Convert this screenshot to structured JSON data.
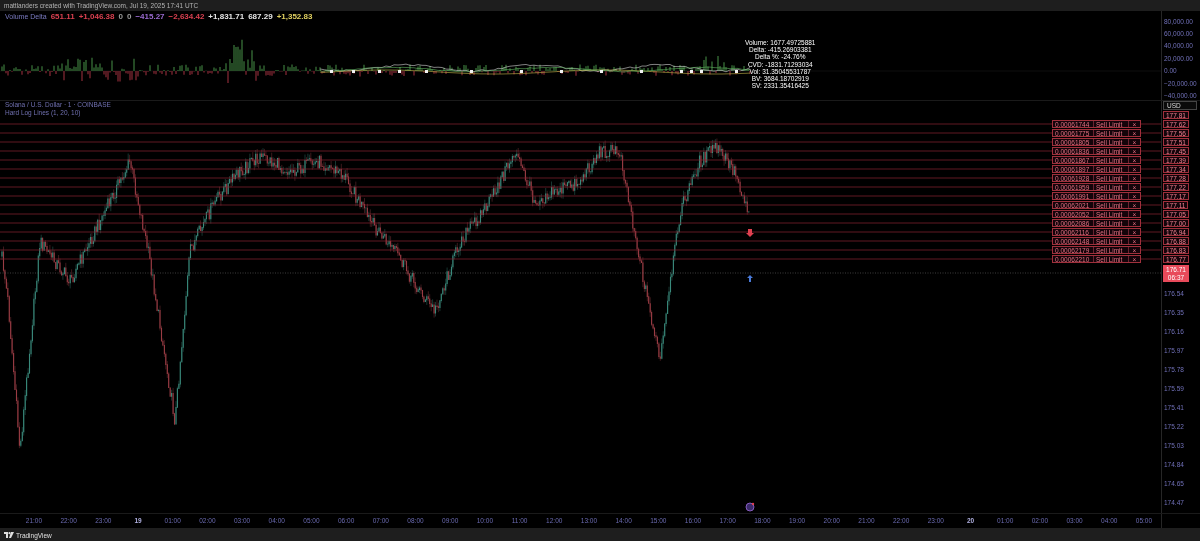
{
  "header": {
    "caption": "mattlanders created with TradingView.com, Jul 19, 2025 17:41 UTC"
  },
  "indicator_pane": {
    "legend": {
      "title": "Volume Delta",
      "values": [
        {
          "text": "651.11",
          "color": "#d94050"
        },
        {
          "text": "+1,046.38",
          "color": "#d94050"
        },
        {
          "text": "0",
          "color": "#9a9a9a"
        },
        {
          "text": "0",
          "color": "#9a9a9a"
        },
        {
          "text": "−415.27",
          "color": "#9a6ad0"
        },
        {
          "text": "−2,634.42",
          "color": "#d94050"
        },
        {
          "text": "+1,831.71",
          "color": "#e6e6e6"
        },
        {
          "text": "687.29",
          "color": "#e6e6e6"
        },
        {
          "text": "+1,352.83",
          "color": "#e0d060"
        }
      ]
    },
    "tooltip": [
      "Volume: 1677.49725881",
      "Delta: -415.26903381",
      "Delta %: -24.76%",
      "CVD: -1831.71293034",
      "Vol: 31.35045531787",
      "BV: 3684.18702919",
      "SV: 2331.35416425"
    ],
    "axis_labels": [
      "80,000.00",
      "60,000.00",
      "40,000.00",
      "20,000.00",
      "0.00",
      "−20,000.00",
      "−40,000.00"
    ]
  },
  "main_pane": {
    "legend": [
      "Solana / U.S. Dollar · 1 · COINBASE",
      "Hard Log Lines (1, 20, 10)"
    ],
    "currency_button": "USD",
    "top_price_label": "177.81",
    "orders": [
      {
        "quantity": "0.00061744",
        "type": "Sell Limit",
        "close": "×",
        "price": "177.62"
      },
      {
        "quantity": "0.00061775",
        "type": "Sell Limit",
        "close": "×",
        "price": "177.56"
      },
      {
        "quantity": "0.00061805",
        "type": "Sell Limit",
        "close": "×",
        "price": "177.51"
      },
      {
        "quantity": "0.00061836",
        "type": "Sell Limit",
        "close": "×",
        "price": "177.45"
      },
      {
        "quantity": "0.00061867",
        "type": "Sell Limit",
        "close": "×",
        "price": "177.39"
      },
      {
        "quantity": "0.00061897",
        "type": "Sell Limit",
        "close": "×",
        "price": "177.34"
      },
      {
        "quantity": "0.00061928",
        "type": "Sell Limit",
        "close": "×",
        "price": "177.28"
      },
      {
        "quantity": "0.00061959",
        "type": "Sell Limit",
        "close": "×",
        "price": "177.22"
      },
      {
        "quantity": "0.00061991",
        "type": "Sell Limit",
        "close": "×",
        "price": "177.17"
      },
      {
        "quantity": "0.00062021",
        "type": "Sell Limit",
        "close": "×",
        "price": "177.11"
      },
      {
        "quantity": "0.00062052",
        "type": "Sell Limit",
        "close": "×",
        "price": "177.05"
      },
      {
        "quantity": "0.00062086",
        "type": "Sell Limit",
        "close": "×",
        "price": "177.00"
      },
      {
        "quantity": "0.00062116",
        "type": "Sell Limit",
        "close": "×",
        "price": "176.94"
      },
      {
        "quantity": "0.00062148",
        "type": "Sell Limit",
        "close": "×",
        "price": "176.88"
      },
      {
        "quantity": "0.00062179",
        "type": "Sell Limit",
        "close": "×",
        "price": "176.83"
      },
      {
        "quantity": "0.00062210",
        "type": "Sell Limit",
        "close": "×",
        "price": "176.77"
      }
    ],
    "current_price": {
      "price": "176.71",
      "countdown": "06:37"
    },
    "axis_labels": [
      "176.54",
      "176.35",
      "176.16",
      "175.97",
      "175.78",
      "175.59",
      "175.41",
      "175.22",
      "175.03",
      "174.84",
      "174.65",
      "174.47"
    ]
  },
  "time_axis": [
    {
      "label": "21:00",
      "kind": "time"
    },
    {
      "label": "22:00",
      "kind": "time"
    },
    {
      "label": "23:00",
      "kind": "time"
    },
    {
      "label": "19",
      "kind": "day"
    },
    {
      "label": "01:00",
      "kind": "time"
    },
    {
      "label": "02:00",
      "kind": "time"
    },
    {
      "label": "03:00",
      "kind": "time"
    },
    {
      "label": "04:00",
      "kind": "time"
    },
    {
      "label": "05:00",
      "kind": "time"
    },
    {
      "label": "06:00",
      "kind": "time"
    },
    {
      "label": "07:00",
      "kind": "time"
    },
    {
      "label": "08:00",
      "kind": "time"
    },
    {
      "label": "09:00",
      "kind": "time"
    },
    {
      "label": "10:00",
      "kind": "time"
    },
    {
      "label": "11:00",
      "kind": "time"
    },
    {
      "label": "12:00",
      "kind": "time"
    },
    {
      "label": "13:00",
      "kind": "time"
    },
    {
      "label": "14:00",
      "kind": "time"
    },
    {
      "label": "15:00",
      "kind": "time"
    },
    {
      "label": "16:00",
      "kind": "time"
    },
    {
      "label": "17:00",
      "kind": "time"
    },
    {
      "label": "18:00",
      "kind": "time"
    },
    {
      "label": "19:00",
      "kind": "time"
    },
    {
      "label": "20:00",
      "kind": "time"
    },
    {
      "label": "21:00",
      "kind": "time"
    },
    {
      "label": "22:00",
      "kind": "time"
    },
    {
      "label": "23:00",
      "kind": "time"
    },
    {
      "label": "20",
      "kind": "day"
    },
    {
      "label": "01:00",
      "kind": "time"
    },
    {
      "label": "02:00",
      "kind": "time"
    },
    {
      "label": "03:00",
      "kind": "time"
    },
    {
      "label": "04:00",
      "kind": "time"
    },
    {
      "label": "05:00",
      "kind": "time"
    }
  ],
  "footer": {
    "brand": "TradingView"
  }
}
